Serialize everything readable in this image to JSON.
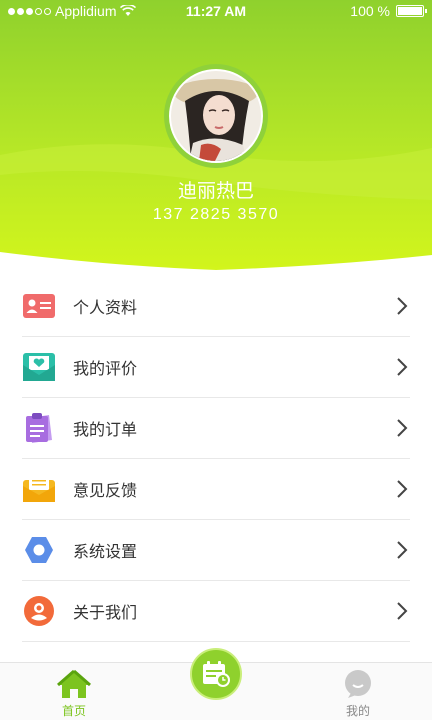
{
  "status_bar": {
    "carrier": "Applidium",
    "time": "11:27 AM",
    "battery": "100 %",
    "signal_icon": "signal-dots-icon",
    "wifi_icon": "wifi-icon",
    "battery_icon": "battery-icon"
  },
  "profile": {
    "name": "迪丽热巴",
    "phone": "137 2825 3570"
  },
  "menu": {
    "items": [
      {
        "label": "个人资料",
        "icon": "id-card-icon",
        "color": "#f06b6b"
      },
      {
        "label": "我的评价",
        "icon": "heart-envelope-icon",
        "color": "#2bbfa8"
      },
      {
        "label": "我的订单",
        "icon": "clipboard-icon",
        "color": "#a86de0"
      },
      {
        "label": "意见反馈",
        "icon": "envelope-icon",
        "color": "#f5b820"
      },
      {
        "label": "系统设置",
        "icon": "hexagon-gear-icon",
        "color": "#5b8de8"
      },
      {
        "label": "关于我们",
        "icon": "people-icon",
        "color": "#f26a3a"
      }
    ]
  },
  "tabbar": {
    "home_label": "首页",
    "mine_label": "我的",
    "center_icon": "calendar-icon"
  },
  "colors": {
    "accent": "#7cc41f",
    "header_top": "#8fd12d",
    "header_bottom": "#cff51e"
  }
}
